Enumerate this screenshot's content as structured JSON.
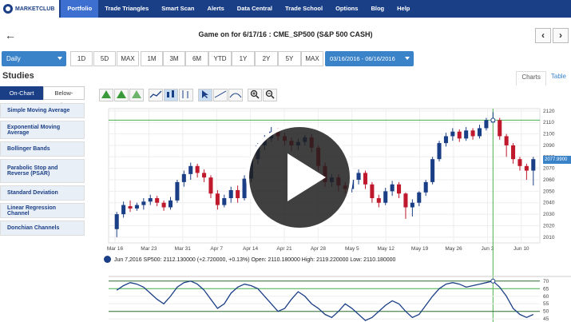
{
  "nav": {
    "logo": "MARKETCLUB",
    "items": [
      "Portfolio",
      "Trade Triangles",
      "Smart Scan",
      "Alerts",
      "Data Central",
      "Trade School",
      "Options",
      "Blog",
      "Help"
    ],
    "active": "Portfolio"
  },
  "title": "Game on for 6/17/16 : CME_SP500 (S&P 500 CASH)",
  "toolbar": {
    "interval": "Daily",
    "ranges1": [
      "1D",
      "5D",
      "MAX"
    ],
    "ranges2": [
      "1M",
      "3M",
      "6M",
      "YTD",
      "1Y",
      "2Y",
      "5Y",
      "MAX"
    ],
    "date_range": "03/16/2016 - 06/16/2016"
  },
  "studies": {
    "heading": "Studies",
    "tabs": [
      "On-Chart",
      "Below-Chart"
    ],
    "items": [
      "Simple Moving Average",
      "Exponential Moving Average",
      "Bollinger Bands",
      "Parabolic Stop and Reverse (PSAR)",
      "Standard Deviation",
      "Linear Regression Channel",
      "Donchian Channels"
    ]
  },
  "view_tabs": [
    "Charts",
    "Table"
  ],
  "legend": "Jun 7,2016 SP500: 2112.130000 (+2.720000, +0.13%) Open: 2110.180000 High: 2119.220000 Low: 2110.180000",
  "price_tag": "2077.9900",
  "colors": {
    "up": "#1b3f86",
    "down": "#c0182c",
    "accent": "#3b83c9",
    "nav": "#1b3f86"
  },
  "chart_data": {
    "type": "candlestick",
    "x_ticks": [
      "Mar 16",
      "Mar 23",
      "Mar 31",
      "Apr 7",
      "Apr 14",
      "Apr 21",
      "Apr 28",
      "May 5",
      "May 12",
      "May 19",
      "May 26",
      "Jun 3",
      "Jun 10"
    ],
    "y_ticks": [
      2010,
      2020,
      2030,
      2040,
      2050,
      2060,
      2070,
      2080,
      2090,
      2100,
      2110,
      2120
    ],
    "ylim": [
      2005,
      2122
    ],
    "candles": [
      [
        2017,
        2030,
        2010,
        2032
      ],
      [
        2030,
        2038,
        2027,
        2041
      ],
      [
        2037,
        2035,
        2032,
        2042
      ],
      [
        2035,
        2038,
        2033,
        2040
      ],
      [
        2038,
        2041,
        2034,
        2044
      ],
      [
        2041,
        2044,
        2038,
        2047
      ],
      [
        2044,
        2040,
        2037,
        2046
      ],
      [
        2040,
        2036,
        2033,
        2042
      ],
      [
        2036,
        2042,
        2034,
        2045
      ],
      [
        2042,
        2058,
        2040,
        2060
      ],
      [
        2058,
        2065,
        2054,
        2068
      ],
      [
        2065,
        2072,
        2060,
        2075
      ],
      [
        2072,
        2066,
        2062,
        2074
      ],
      [
        2066,
        2062,
        2058,
        2069
      ],
      [
        2062,
        2048,
        2044,
        2064
      ],
      [
        2048,
        2038,
        2034,
        2051
      ],
      [
        2038,
        2044,
        2036,
        2047
      ],
      [
        2044,
        2051,
        2040,
        2054
      ],
      [
        2051,
        2044,
        2040,
        2055
      ],
      [
        2044,
        2061,
        2042,
        2064
      ],
      [
        2061,
        2078,
        2058,
        2080
      ],
      [
        2078,
        2090,
        2074,
        2092
      ],
      [
        2090,
        2096,
        2086,
        2099
      ],
      [
        2096,
        2102,
        2093,
        2106
      ],
      [
        2102,
        2098,
        2094,
        2105
      ],
      [
        2098,
        2094,
        2090,
        2101
      ],
      [
        2094,
        2090,
        2085,
        2097
      ],
      [
        2090,
        2093,
        2086,
        2096
      ],
      [
        2093,
        2097,
        2090,
        2099
      ],
      [
        2097,
        2088,
        2084,
        2100
      ],
      [
        2088,
        2072,
        2068,
        2090
      ],
      [
        2072,
        2058,
        2054,
        2075
      ],
      [
        2058,
        2062,
        2054,
        2065
      ],
      [
        2062,
        2055,
        2050,
        2065
      ],
      [
        2055,
        2052,
        2048,
        2058
      ],
      [
        2052,
        2060,
        2049,
        2063
      ],
      [
        2060,
        2066,
        2056,
        2069
      ],
      [
        2066,
        2056,
        2052,
        2068
      ],
      [
        2056,
        2044,
        2040,
        2058
      ],
      [
        2044,
        2040,
        2036,
        2047
      ],
      [
        2040,
        2050,
        2038,
        2053
      ],
      [
        2050,
        2056,
        2046,
        2059
      ],
      [
        2056,
        2048,
        2044,
        2058
      ],
      [
        2048,
        2036,
        2026,
        2049
      ],
      [
        2036,
        2040,
        2028,
        2043
      ],
      [
        2040,
        2049,
        2037,
        2050
      ],
      [
        2049,
        2058,
        2046,
        2060
      ],
      [
        2058,
        2078,
        2056,
        2080
      ],
      [
        2078,
        2092,
        2076,
        2094
      ],
      [
        2092,
        2098,
        2089,
        2101
      ],
      [
        2098,
        2102,
        2094,
        2105
      ],
      [
        2102,
        2096,
        2093,
        2104
      ],
      [
        2096,
        2103,
        2094,
        2106
      ],
      [
        2103,
        2098,
        2095,
        2105
      ],
      [
        2098,
        2105,
        2096,
        2108
      ],
      [
        2105,
        2112,
        2103,
        2114
      ],
      [
        2110,
        2112,
        2110,
        2119
      ],
      [
        2112,
        2098,
        2095,
        2114
      ],
      [
        2098,
        2090,
        2080,
        2100
      ],
      [
        2090,
        2078,
        2074,
        2092
      ],
      [
        2078,
        2072,
        2068,
        2080
      ],
      [
        2072,
        2068,
        2060,
        2074
      ],
      [
        2068,
        2078,
        2055,
        2080
      ]
    ],
    "osc_ticks": [
      45,
      50,
      55,
      60,
      65,
      70
    ],
    "osc_lim": [
      43,
      72
    ],
    "oscillator": [
      64,
      67,
      69,
      68,
      66,
      62,
      58,
      55,
      60,
      66,
      69,
      70,
      68,
      64,
      58,
      52,
      55,
      62,
      66,
      68,
      67,
      65,
      60,
      55,
      50,
      52,
      58,
      63,
      60,
      55,
      52,
      48,
      46,
      50,
      55,
      52,
      48,
      44,
      46,
      50,
      54,
      57,
      55,
      50,
      46,
      48,
      54,
      60,
      65,
      68,
      69,
      68,
      66,
      67,
      68,
      69,
      70,
      66,
      60,
      52,
      48,
      46,
      48
    ]
  }
}
